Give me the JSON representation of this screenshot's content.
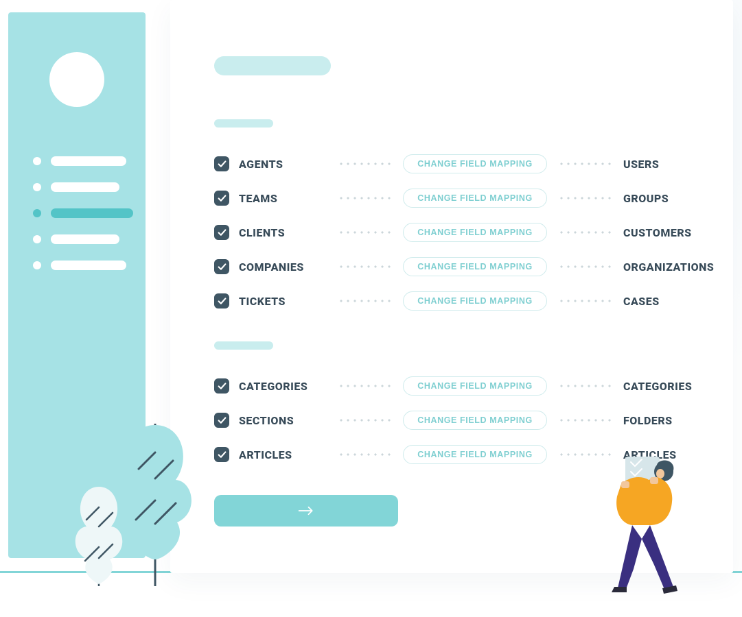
{
  "colors": {
    "sidebar": "#a6e2e5",
    "accent": "#82d5d7",
    "accent_dark": "#53c4c7",
    "placeholder": "#c9edee",
    "text": "#374a58",
    "checkbox": "#3f5664",
    "btn_border": "#cfebec",
    "btn_text": "#7fcfd1"
  },
  "buttons": {
    "change_field_mapping": "CHANGE FIELD MAPPING"
  },
  "groups": [
    {
      "rows": [
        {
          "source": "AGENTS",
          "target": "USERS"
        },
        {
          "source": "TEAMS",
          "target": "GROUPS"
        },
        {
          "source": "CLIENTS",
          "target": "CUSTOMERS"
        },
        {
          "source": "COMPANIES",
          "target": "ORGANIZATIONS"
        },
        {
          "source": "TICKETS",
          "target": "CASES"
        }
      ]
    },
    {
      "rows": [
        {
          "source": "CATEGORIES",
          "target": "CATEGORIES"
        },
        {
          "source": "SECTIONS",
          "target": "FOLDERS"
        },
        {
          "source": "ARTICLES",
          "target": "ARTICLES"
        }
      ]
    }
  ]
}
